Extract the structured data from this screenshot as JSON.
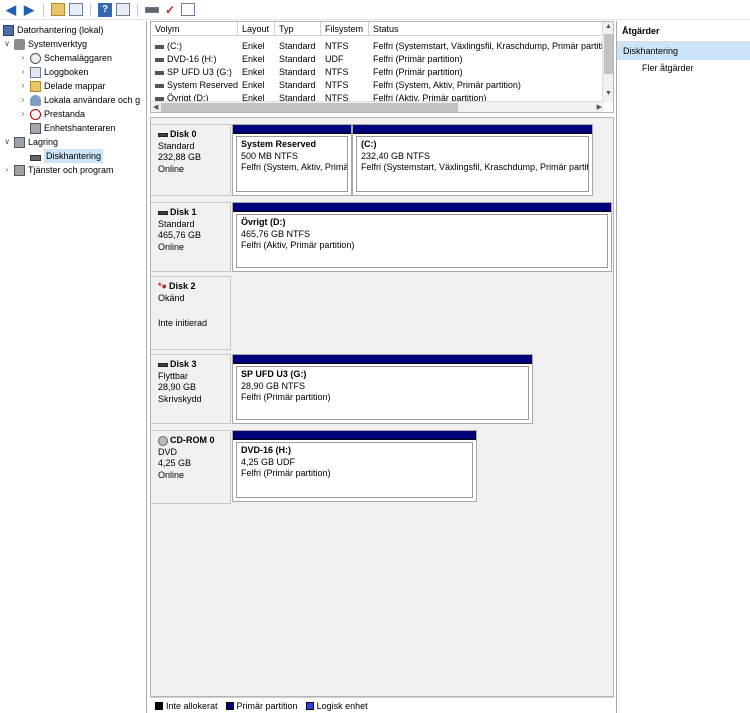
{
  "toolbar": {
    "buttons": [
      "back-icon",
      "forward-icon",
      "up-folder-icon",
      "show-tree-icon",
      "help-icon",
      "properties-icon",
      "connect-icon",
      "check-icon",
      "console-icon"
    ]
  },
  "tree": {
    "root": "Datorhantering (lokal)",
    "system_tools": "Systemverktyg",
    "scheduler": "Schemaläggaren",
    "event_viewer": "Loggboken",
    "shared_folders": "Delade mappar",
    "local_users": "Lokala användare och g",
    "performance": "Prestanda",
    "device_manager": "Enhetshanteraren",
    "storage": "Lagring",
    "disk_management": "Diskhantering",
    "services": "Tjänster och program"
  },
  "volume_list": {
    "columns": [
      "Volym",
      "Layout",
      "Typ",
      "Filsystem",
      "Status"
    ],
    "rows": [
      {
        "volume": "(C:)",
        "layout": "Enkel",
        "type": "Standard",
        "fs": "NTFS",
        "status": "Felfri (Systemstart, Växlingsfil, Kraschdump, Primär partition)"
      },
      {
        "volume": "DVD-16 (H:)",
        "layout": "Enkel",
        "type": "Standard",
        "fs": "UDF",
        "status": "Felfri (Primär partition)"
      },
      {
        "volume": "SP UFD U3 (G:)",
        "layout": "Enkel",
        "type": "Standard",
        "fs": "NTFS",
        "status": "Felfri (Primär partition)"
      },
      {
        "volume": "System Reserved",
        "layout": "Enkel",
        "type": "Standard",
        "fs": "NTFS",
        "status": "Felfri (System, Aktiv, Primär partition)"
      },
      {
        "volume": "Övrigt (D:)",
        "layout": "Enkel",
        "type": "Standard",
        "fs": "NTFS",
        "status": "Felfri (Aktiv, Primär partition)"
      }
    ]
  },
  "disks": [
    {
      "name": "Disk 0",
      "line1": "Standard",
      "line2": "232,88 GB",
      "line3": "Online",
      "partitions": [
        {
          "name": "System Reserved",
          "size": "500 MB NTFS",
          "status": "Felfri (System, Aktiv, Primär partition)"
        },
        {
          "name": "(C:)",
          "size": "232,40 GB NTFS",
          "status": "Felfri (Systemstart, Växlingsfil, Kraschdump, Primär partition)"
        }
      ]
    },
    {
      "name": "Disk 1",
      "line1": "Standard",
      "line2": "465,76 GB",
      "line3": "Online",
      "partitions": [
        {
          "name": "Övrigt  (D:)",
          "size": "465,76 GB NTFS",
          "status": "Felfri (Aktiv, Primär partition)"
        }
      ]
    },
    {
      "name": "Disk 2",
      "line1": "Okänd",
      "line2": "",
      "line3": "Inte initierad",
      "partitions": []
    },
    {
      "name": "Disk 3",
      "line1": "Flyttbar",
      "line2": "28,90 GB",
      "line3": "Skrivskydd",
      "partitions": [
        {
          "name": "SP UFD U3  (G:)",
          "size": "28,90 GB NTFS",
          "status": "Felfri (Primär partition)"
        }
      ]
    },
    {
      "name": "CD-ROM 0",
      "line1": "DVD",
      "line2": "4,25 GB",
      "line3": "Online",
      "partitions": [
        {
          "name": "DVD-16  (H:)",
          "size": "4,25 GB UDF",
          "status": "Felfri (Primär partition)"
        }
      ]
    }
  ],
  "legend": {
    "unallocated": "Inte allokerat",
    "primary": "Primär partition",
    "logical": "Logisk enhet",
    "colors": {
      "unallocated": "#000000",
      "primary": "#00007d",
      "logical": "#2f3cf0"
    }
  },
  "actions": {
    "title": "Åtgärder",
    "selected": "Diskhantering",
    "more": "Fler åtgärder"
  }
}
